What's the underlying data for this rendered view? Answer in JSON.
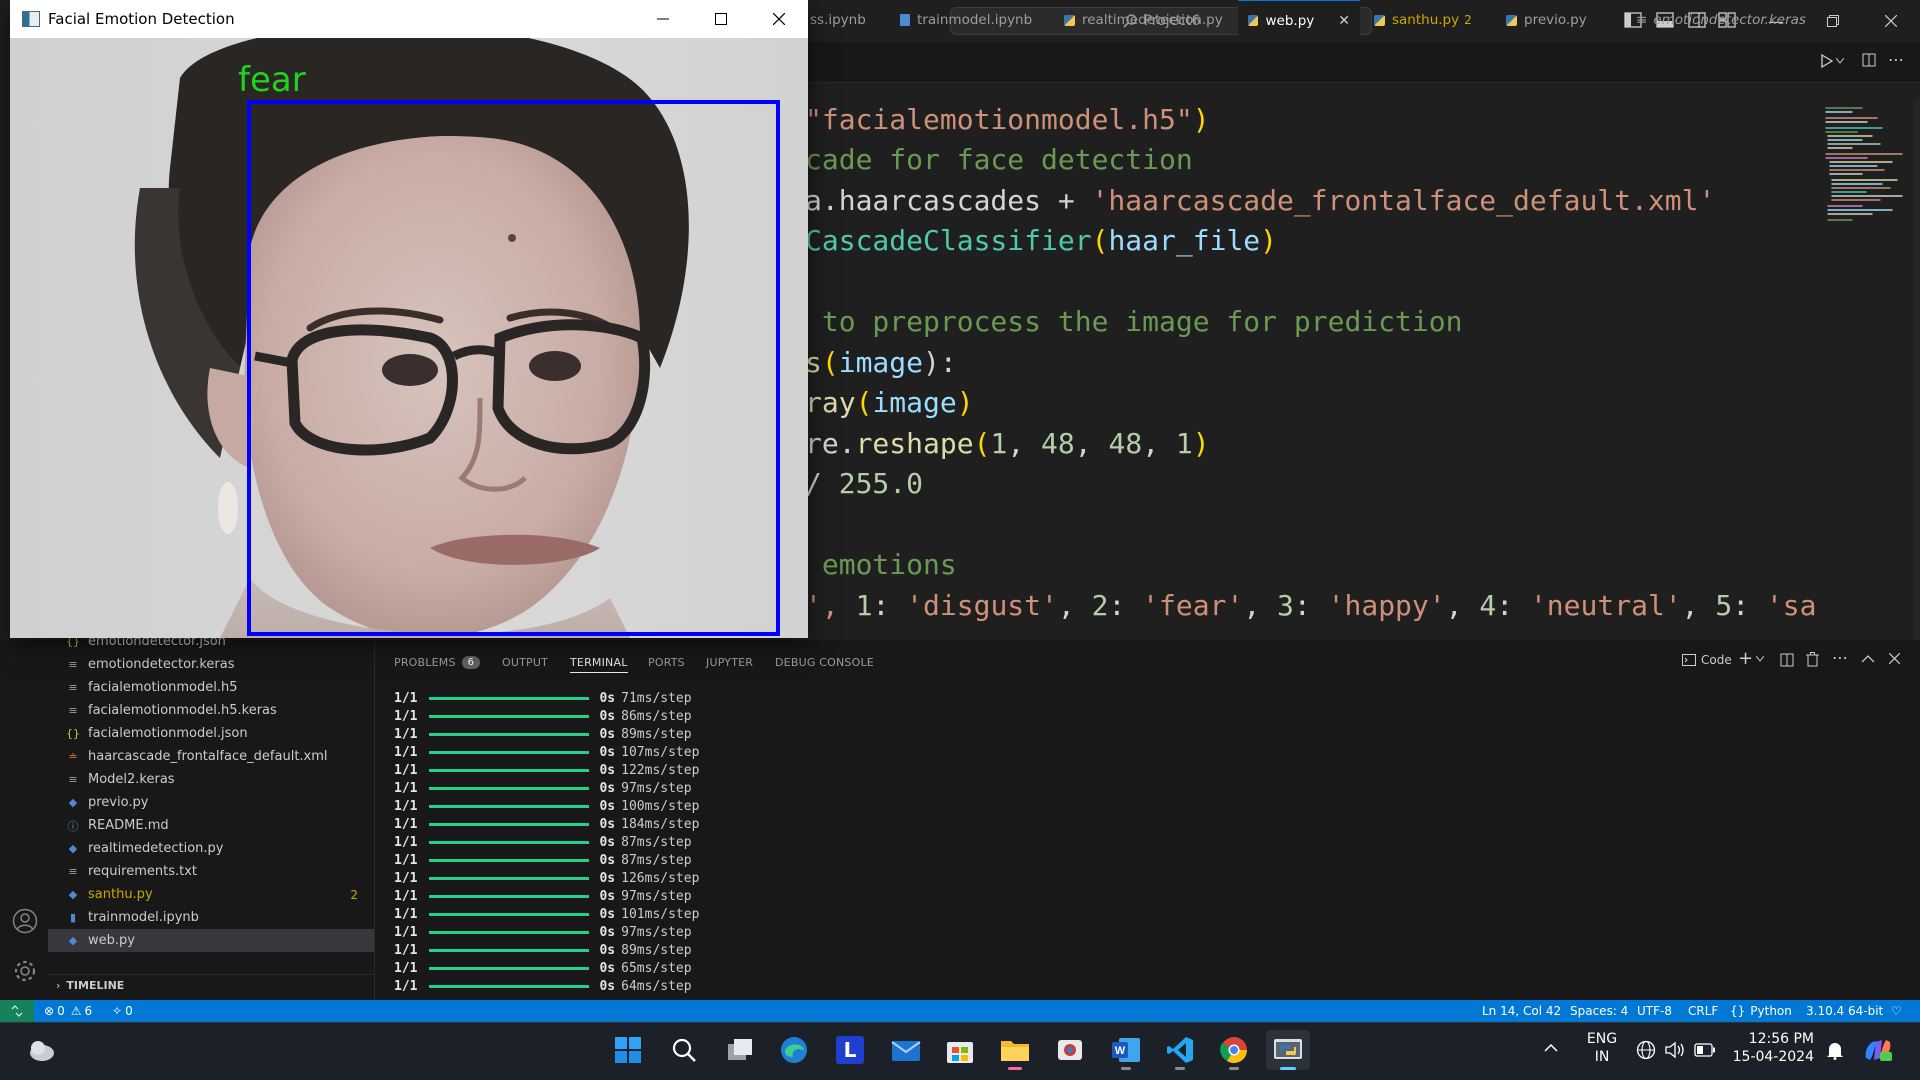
{
  "vscode": {
    "search_label": "Project6",
    "tabs": [
      {
        "label": "ss.ipynb",
        "kind": "notebook"
      },
      {
        "label": "trainmodel.ipynb",
        "kind": "notebook"
      },
      {
        "label": "realtimedetection.py",
        "kind": "python"
      },
      {
        "label": "web.py",
        "kind": "python",
        "active": true,
        "close": "✕"
      },
      {
        "label": "santhu.py",
        "kind": "python",
        "badge": "2"
      },
      {
        "label": "previo.py",
        "kind": "python"
      },
      {
        "label": "emotiondetector.keras",
        "kind": "file"
      }
    ],
    "code": {
      "l1a": "\"facialemotionmodel.h5\"",
      "l1b": ")",
      "l2": "cade for face detection",
      "l3a": "a.haarcascades + ",
      "l3b": "'haarcascade_frontalface_default.xml'",
      "l4a": "CascadeClassifier",
      "l4b": "(",
      "l4c": "haar_file",
      "l4d": ")",
      "l5": " to preprocess the image for prediction",
      "l6a": "s",
      "l6b": "(",
      "l6c": "image",
      "l6d": "):",
      "l7a": "ray",
      "l7b": "(",
      "l7c": "image",
      "l7d": ")",
      "l8a": "re.",
      "l8b": "reshape",
      "l8c": "(",
      "l8d": "1",
      "l8e": ", ",
      "l8f": "48",
      "l8g": ", ",
      "l8h": "48",
      "l8i": ", ",
      "l8j": "1",
      "l8k": ")",
      "l9a": "/ ",
      "l9b": "255.0",
      "l10": " emotions",
      "l11a": "', ",
      "l11b": "1",
      "l11c": ": ",
      "l11d": "'disgust'",
      "l11e": ", ",
      "l11f": "2",
      "l11g": ": ",
      "l11h": "'fear'",
      "l11i": ", ",
      "l11j": "3",
      "l11k": ": ",
      "l11l": "'happy'",
      "l11m": ", ",
      "l11n": "4",
      "l11o": ": ",
      "l11p": "'neutral'",
      "l11q": ", ",
      "l11r": "5",
      "l11s": ": ",
      "l11t": "'sad"
    },
    "explorer_files": [
      {
        "name": "emotiondetector.json",
        "icon": "{}"
      },
      {
        "name": "emotiondetector.keras",
        "icon": "≡"
      },
      {
        "name": "facialemotionmodel.h5",
        "icon": "≡"
      },
      {
        "name": "facialemotionmodel.h5.keras",
        "icon": "≡"
      },
      {
        "name": "facialemotionmodel.json",
        "icon": "{}"
      },
      {
        "name": "haarcascade_frontalface_default.xml",
        "icon": "rss"
      },
      {
        "name": "Model2.keras",
        "icon": "≡"
      },
      {
        "name": "previo.py",
        "icon": "py"
      },
      {
        "name": "README.md",
        "icon": "ⓘ"
      },
      {
        "name": "realtimedetection.py",
        "icon": "py"
      },
      {
        "name": "requirements.txt",
        "icon": "≡"
      },
      {
        "name": "santhu.py",
        "icon": "py",
        "badge": "2"
      },
      {
        "name": "trainmodel.ipynb",
        "icon": "nb"
      },
      {
        "name": "web.py",
        "icon": "py",
        "selected": true
      }
    ],
    "timeline_label": "TIMELINE",
    "panel_tabs": [
      {
        "label": "PROBLEMS",
        "badge": "6"
      },
      {
        "label": "OUTPUT"
      },
      {
        "label": "TERMINAL",
        "active": true
      },
      {
        "label": "PORTS"
      },
      {
        "label": "JUPYTER"
      },
      {
        "label": "DEBUG CONSOLE"
      }
    ],
    "terminal_launch_label": "Code",
    "terminal_rows": [
      {
        "step": "1/1",
        "time": "0s",
        "ms": "71ms/step"
      },
      {
        "step": "1/1",
        "time": "0s",
        "ms": "86ms/step"
      },
      {
        "step": "1/1",
        "time": "0s",
        "ms": "89ms/step"
      },
      {
        "step": "1/1",
        "time": "0s",
        "ms": "107ms/step"
      },
      {
        "step": "1/1",
        "time": "0s",
        "ms": "122ms/step"
      },
      {
        "step": "1/1",
        "time": "0s",
        "ms": "97ms/step"
      },
      {
        "step": "1/1",
        "time": "0s",
        "ms": "100ms/step"
      },
      {
        "step": "1/1",
        "time": "0s",
        "ms": "184ms/step"
      },
      {
        "step": "1/1",
        "time": "0s",
        "ms": "87ms/step"
      },
      {
        "step": "1/1",
        "time": "0s",
        "ms": "87ms/step"
      },
      {
        "step": "1/1",
        "time": "0s",
        "ms": "126ms/step"
      },
      {
        "step": "1/1",
        "time": "0s",
        "ms": "97ms/step"
      },
      {
        "step": "1/1",
        "time": "0s",
        "ms": "101ms/step"
      },
      {
        "step": "1/1",
        "time": "0s",
        "ms": "97ms/step"
      },
      {
        "step": "1/1",
        "time": "0s",
        "ms": "89ms/step"
      },
      {
        "step": "1/1",
        "time": "0s",
        "ms": "65ms/step"
      },
      {
        "step": "1/1",
        "time": "0s",
        "ms": "64ms/step"
      }
    ],
    "status": {
      "errors": "0",
      "warnings": "6",
      "ports": "0",
      "position": "Ln 14, Col 42",
      "spaces": "Spaces: 4",
      "encoding": "UTF-8",
      "eol": "CRLF",
      "language": "Python",
      "interpreter": "3.10.4 64-bit"
    }
  },
  "cv_window": {
    "title": "Facial Emotion Detection",
    "emotion_label": "fear",
    "box_color": "#0000ff",
    "label_color": "#1fd31f"
  },
  "taskbar": {
    "language_line1": "ENG",
    "language_line2": "IN",
    "time": "12:56 PM",
    "date": "15-04-2024",
    "pinned_icons": [
      "start-icon",
      "search-icon",
      "task-view-icon",
      "edge-icon",
      "l-app-icon",
      "mail-icon",
      "store-icon",
      "file-explorer-icon",
      "snipping-icon",
      "word-icon",
      "vscode-icon",
      "chrome-icon",
      "python-icon"
    ]
  },
  "colors": {
    "accent": "#0078d4",
    "editor_bg": "#1f1f1f",
    "terminal_bar": "#23d18b"
  }
}
